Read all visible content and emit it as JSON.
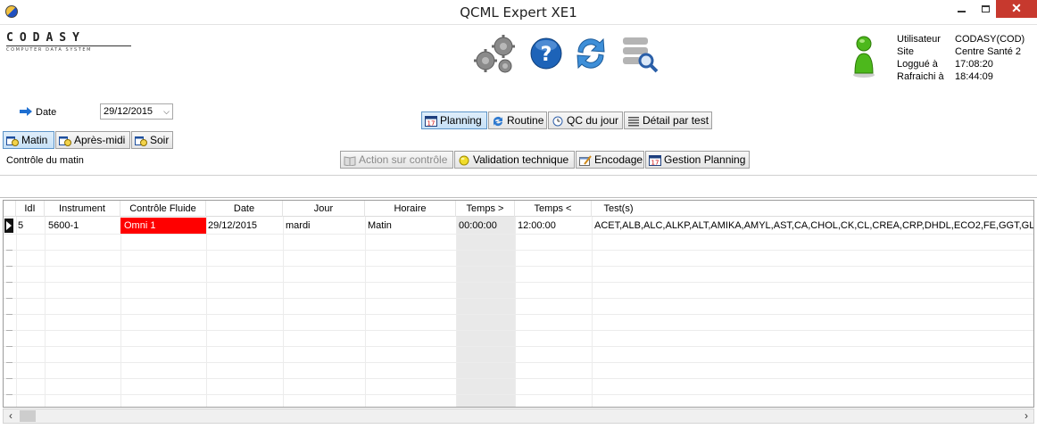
{
  "window": {
    "title": "QCML Expert XE1",
    "minimize": "minimize",
    "maximize": "maximize",
    "close_label": "✕"
  },
  "logo": {
    "main": "CODASY",
    "sub": "COMPUTER DATA SYSTEM"
  },
  "toolbar": {
    "icons": [
      "settings-icon",
      "help-icon",
      "refresh-icon",
      "search-list-icon"
    ]
  },
  "user_info": {
    "rows": [
      {
        "label": "Utilisateur",
        "value": "CODASY(COD)"
      },
      {
        "label": "Site",
        "value": "Centre Santé 2"
      },
      {
        "label": "Loggué à",
        "value": "17:08:20"
      },
      {
        "label": "Rafraichi à",
        "value": "18:44:09"
      }
    ]
  },
  "date": {
    "label": "Date",
    "value": "29/12/2015"
  },
  "shifts": [
    {
      "label": "Matin",
      "active": true
    },
    {
      "label": "Après-midi",
      "active": false
    },
    {
      "label": "Soir",
      "active": false
    }
  ],
  "controle_label": "Contrôle du matin",
  "views": [
    {
      "label": "Planning",
      "active": true
    },
    {
      "label": "Routine",
      "active": false
    },
    {
      "label": "QC du jour",
      "active": false
    },
    {
      "label": "Détail par test",
      "active": false
    }
  ],
  "actions": [
    {
      "label": "Action sur contrôle",
      "disabled": true
    },
    {
      "label": "Validation technique",
      "disabled": false
    },
    {
      "label": "Encodage",
      "disabled": false
    },
    {
      "label": "Gestion Planning",
      "disabled": false
    }
  ],
  "grid": {
    "columns": [
      "IdI",
      "Instrument",
      "Contrôle Fluide",
      "Date",
      "Jour",
      "Horaire",
      "Temps >",
      "Temps <",
      "Test(s)"
    ],
    "rows": [
      {
        "idi": "5",
        "instrument": "5600-1",
        "controle_fluide": "Omni 1",
        "date": "29/12/2015",
        "jour": "mardi",
        "horaire": "Matin",
        "temps_gt": "00:00:00",
        "temps_lt": "12:00:00",
        "tests": "ACET,ALB,ALC,ALKP,ALT,AMIKA,AMYL,AST,CA,CHOL,CK,CL,CREA,CRP,DHDL,ECO2,FE,GGT,GLU,LAC"
      }
    ]
  },
  "colors": {
    "controle_fluide_highlight": "#ff0000",
    "close_button": "#c7392e"
  }
}
